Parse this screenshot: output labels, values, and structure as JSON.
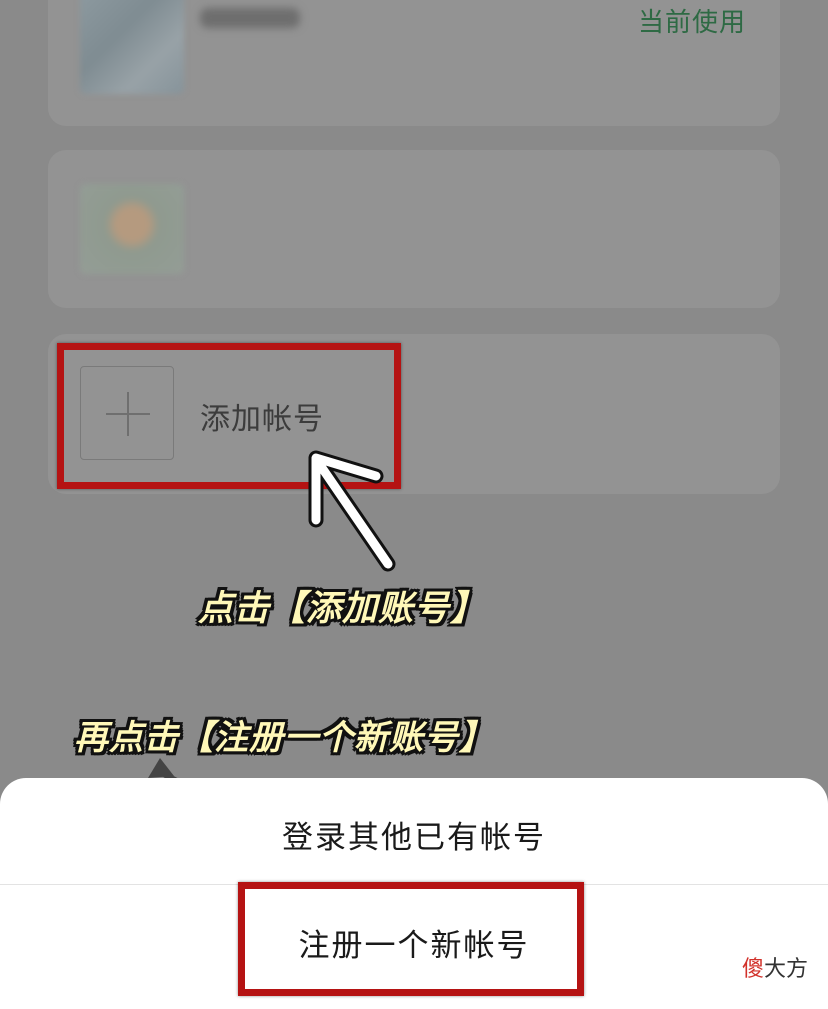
{
  "accounts": {
    "current_label": "当前使用",
    "add_account_label": "添加帐号"
  },
  "annotations": {
    "step1": "点击【添加账号】",
    "step2": "再点击【注册一个新账号】"
  },
  "action_sheet": {
    "login_existing": "登录其他已有帐号",
    "register_new": "注册一个新帐号"
  },
  "watermark": {
    "accent": "傻",
    "rest": "大方"
  },
  "colors": {
    "highlight": "#b51313",
    "current_label": "#2e6a44",
    "annotation_text": "#fff8b8"
  },
  "icons": {
    "add": "plus-icon",
    "arrow": "curved-arrow-icon"
  }
}
